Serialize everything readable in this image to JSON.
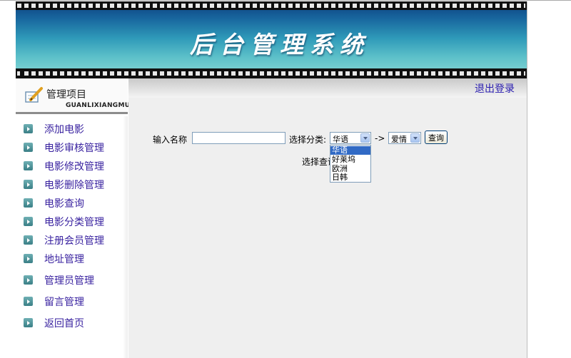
{
  "banner": {
    "title": "后台管理系统"
  },
  "sidebar": {
    "title": "管理项目",
    "subtitle": "GUANLIXIANGMU",
    "items": [
      {
        "label": "添加电影"
      },
      {
        "label": "电影审核管理"
      },
      {
        "label": "电影修改管理"
      },
      {
        "label": "电影删除管理"
      },
      {
        "label": "电影查询"
      },
      {
        "label": "电影分类管理"
      },
      {
        "label": "注册会员管理"
      },
      {
        "label": "地址管理"
      },
      {
        "label": "管理员管理"
      },
      {
        "label": "留言管理"
      },
      {
        "label": "返回首页"
      }
    ]
  },
  "header": {
    "logout": "退出登录"
  },
  "search": {
    "name_label": "输入名称",
    "name_value": "",
    "category_label": "选择分类:",
    "category_selected": "华语",
    "arrow_text": "->",
    "sub_selected": "爱情",
    "query_button": "查询",
    "result_label": "选择查询"
  },
  "dropdown": {
    "options": [
      {
        "label": "华语",
        "selected": true
      },
      {
        "label": "好莱坞",
        "selected": false
      },
      {
        "label": "欧洲",
        "selected": false
      },
      {
        "label": "日韩",
        "selected": false
      }
    ]
  },
  "colors": {
    "nav_link": "#3a23a0",
    "logout_link": "#2a1db0",
    "selection": "#316ac5",
    "main_bg": "#efefef"
  }
}
